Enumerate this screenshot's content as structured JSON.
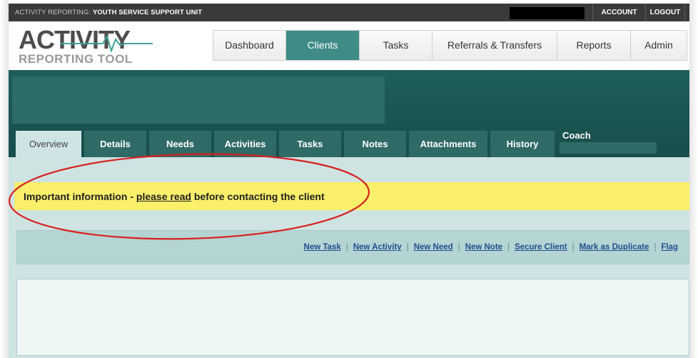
{
  "topbar": {
    "unit_prefix": "ACTIVITY REPORTING: ",
    "unit_name": "YOUTH SERVICE SUPPORT UNIT",
    "account_label": "ACCOUNT",
    "logout_label": "LOGOUT"
  },
  "logo": {
    "line1": "ACTIVITY",
    "line2": "REPORTING TOOL"
  },
  "main_nav": {
    "items": [
      "Dashboard",
      "Clients",
      "Tasks",
      "Referrals & Transfers",
      "Reports",
      "Admin"
    ],
    "active": "Clients"
  },
  "client_tabs": {
    "items": [
      "Overview",
      "Details",
      "Needs",
      "Activities",
      "Tasks",
      "Notes",
      "Attachments",
      "History"
    ],
    "active": "Overview",
    "coach_label": "Coach"
  },
  "notice": {
    "before": "Important information - ",
    "link": "please read",
    "after": " before contacting the client"
  },
  "actions": [
    "New Task",
    "New Activity",
    "New Need",
    "New Note",
    "Secure Client",
    "Mark as Duplicate",
    "Flag"
  ],
  "action_separator": "|",
  "colors": {
    "teal_band": "#1f5e5b",
    "active_nav": "#3f8b86",
    "notice_bg": "#fbf06a",
    "highlight_oval": "#d8201e",
    "link": "#1f4e8c"
  }
}
